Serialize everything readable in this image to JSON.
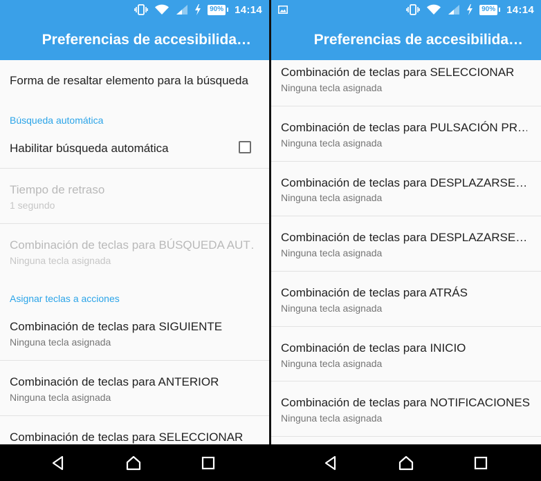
{
  "status": {
    "time": "14:14",
    "battery": "90%"
  },
  "left": {
    "title": "Preferencias de accesibilida…",
    "items": [
      {
        "title": "Forma de resaltar elemento para la búsqueda"
      },
      {
        "category": "Búsqueda automática"
      },
      {
        "title": "Habilitar búsqueda automática",
        "checked": false
      },
      {
        "title": "Tiempo de retraso",
        "summary": "1 segundo",
        "enabled": false
      },
      {
        "title": "Combinación de teclas para BÚSQUEDA AUT…",
        "summary": "Ninguna tecla asignada",
        "enabled": false
      },
      {
        "category": "Asignar teclas a acciones"
      },
      {
        "title": "Combinación de teclas para SIGUIENTE",
        "summary": "Ninguna tecla asignada"
      },
      {
        "title": "Combinación de teclas para ANTERIOR",
        "summary": "Ninguna tecla asignada"
      },
      {
        "title": "Combinación de teclas para SELECCIONAR"
      }
    ]
  },
  "right": {
    "title": "Preferencias de accesibilida…",
    "items": [
      {
        "title": "Combinación de teclas para SELECCIONAR",
        "summary": "Ninguna tecla asignada"
      },
      {
        "title": "Combinación de teclas para PULSACIÓN PR…",
        "summary": "Ninguna tecla asignada"
      },
      {
        "title": "Combinación de teclas para DESPLAZARSE…",
        "summary": "Ninguna tecla asignada"
      },
      {
        "title": "Combinación de teclas para DESPLAZARSE…",
        "summary": "Ninguna tecla asignada"
      },
      {
        "title": "Combinación de teclas para ATRÁS",
        "summary": "Ninguna tecla asignada"
      },
      {
        "title": "Combinación de teclas para INICIO",
        "summary": "Ninguna tecla asignada"
      },
      {
        "title": "Combinación de teclas para NOTIFICACIONES",
        "summary": "Ninguna tecla asignada"
      }
    ]
  },
  "navbar": {
    "buttons": [
      "back-icon",
      "home-icon",
      "recents-icon"
    ]
  },
  "colors": {
    "accent": "#3aa0e8",
    "category": "#2ba4e8"
  }
}
